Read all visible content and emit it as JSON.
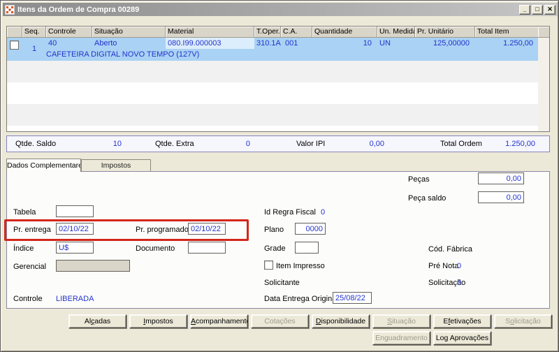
{
  "colors": {
    "selection_bg": "#A9D2F4",
    "material_cell_bg": "#DCEDFC",
    "value_text_blue": "#2233CC",
    "annotation_red": "#D3261B",
    "summary_border": "#8585BE",
    "window_bg": "#ECE9D8"
  },
  "window": {
    "title": "Itens da Ordem de Compra 00289",
    "minimize_glyph": "_",
    "maximize_glyph": "□",
    "close_glyph": "✕"
  },
  "grid": {
    "columns": [
      "",
      "Seq.",
      "Controle",
      "Situação",
      "Material",
      "T.Oper.",
      "C.A.",
      "Quantidade",
      "Un. Medida",
      "Pr. Unitário",
      "Total Item"
    ],
    "row": {
      "seq": "1",
      "controle": "40",
      "situacao": "Aberto",
      "material": "080.I99.000003",
      "t_oper": "310.1A",
      "ca": "001",
      "quantidade": "10",
      "un_medida": "UN",
      "pr_unitario": "125,00000",
      "total_item": "1.250,00",
      "descricao": "CAFETEIRA DIGITAL NOVO TEMPO (127V)"
    }
  },
  "summary": {
    "qtde_saldo_label": "Qtde. Saldo",
    "qtde_saldo_value": "10",
    "qtde_extra_label": "Qtde. Extra",
    "qtde_extra_value": "0",
    "valor_ipi_label": "Valor IPI",
    "valor_ipi_value": "0,00",
    "total_ordem_label": "Total Ordem",
    "total_ordem_value": "1.250,00"
  },
  "tabs": {
    "dados": "Dados Complementares",
    "impostos": "Impostos"
  },
  "form": {
    "pecas_label": "Peças",
    "pecas_value": "0,00",
    "peca_saldo_label": "Peça saldo",
    "peca_saldo_value": "0,00",
    "tabela_label": "Tabela",
    "tabela_value": "",
    "id_regra_fiscal_label": "Id Regra Fiscal",
    "id_regra_fiscal_value": "0",
    "pr_entrega_label": "Pr. entrega",
    "pr_entrega_value": "02/10/22",
    "pr_programado_label": "Pr. programado",
    "pr_programado_value": "02/10/22",
    "plano_label": "Plano",
    "plano_value": "0000",
    "indice_label": "Índice",
    "indice_value": "U$",
    "documento_label": "Documento",
    "documento_value": "",
    "grade_label": "Grade",
    "grade_value": "",
    "cod_fabrica_label": "Cód. Fábrica",
    "gerencial_label": "Gerencial",
    "gerencial_value": "",
    "item_impresso_label": "Item Impresso",
    "pre_nota_label": "Pré Nota",
    "pre_nota_value": "0",
    "solicitante_label": "Solicitante",
    "solicitacao_label": "Solicitação",
    "solicitacao_value": "0",
    "controle_label": "Controle",
    "controle_value": "LIBERADA",
    "data_entrega_label": "Data Entrega Original",
    "data_entrega_value": "25/08/22"
  },
  "buttons": {
    "alcadas": {
      "label": "Al&çadas",
      "enabled": true
    },
    "impostos": {
      "label": "&Impostos",
      "enabled": true
    },
    "acompanhamento": {
      "label": "&Acompanhamento",
      "enabled": true
    },
    "cotacoes": {
      "label": "Cotações",
      "enabled": false
    },
    "disponibilidade": {
      "label": "&Disponibilidade",
      "enabled": true
    },
    "situacao": {
      "label": "&Situação",
      "enabled": false
    },
    "efetivacoes": {
      "label": "E&fetivações",
      "enabled": true
    },
    "solicitacao": {
      "label": "S&olicitação",
      "enabled": false
    },
    "enquadramento": {
      "label": "Enguadramento",
      "enabled": false
    },
    "log_aprovacoes": {
      "label": "Log Aprovações",
      "enabled": true
    }
  }
}
